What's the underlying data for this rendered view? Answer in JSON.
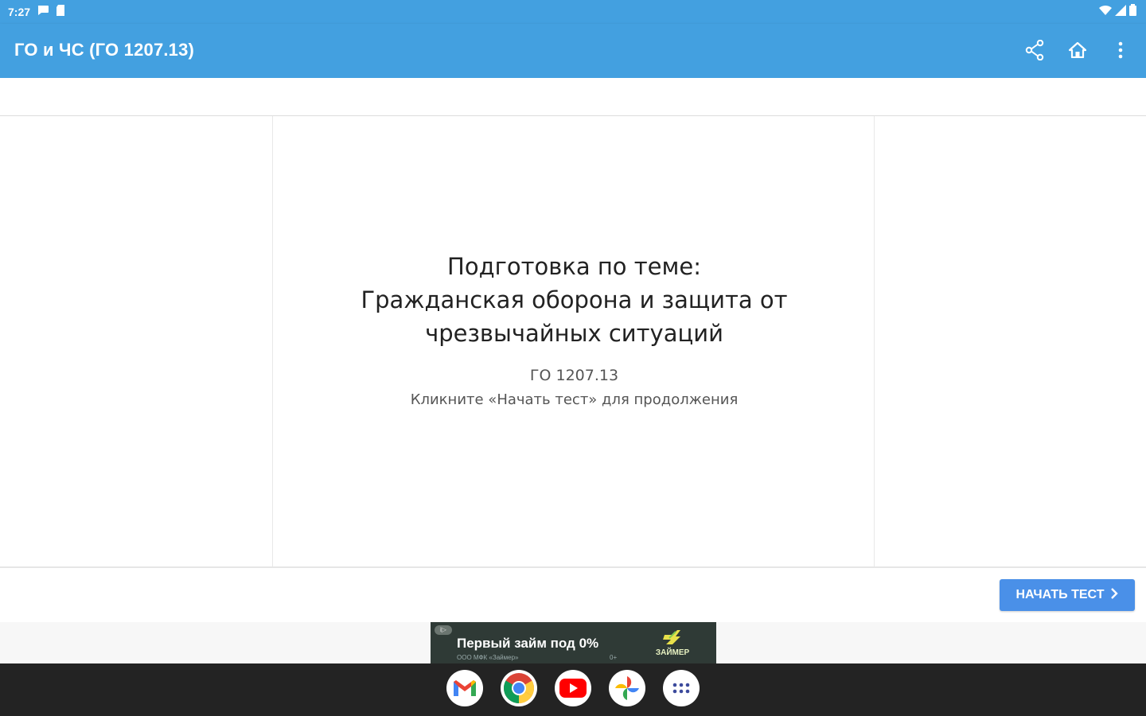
{
  "status_bar": {
    "time": "7:27"
  },
  "app_bar": {
    "title": "ГО и ЧС (ГО 1207.13)",
    "actions": [
      "share-icon",
      "home-icon",
      "more-vert-icon"
    ]
  },
  "slide": {
    "heading_line1": "Подготовка по теме:",
    "heading_line2": "Гражданская оборона и защита от",
    "heading_line3": "чрезвычайных ситуаций",
    "code": "ГО 1207.13",
    "hint": "Кликните «Начать тест» для продолжения"
  },
  "start_button": {
    "label": "НАЧАТЬ ТЕСТ"
  },
  "ad": {
    "title": "Первый займ под 0%",
    "subtitle": "ООО МФК «Займер»",
    "age": "0+",
    "brand": "ЗАЙМЕР"
  },
  "dock": {
    "apps": [
      "gmail-icon",
      "chrome-icon",
      "youtube-icon",
      "photos-icon",
      "app-drawer-icon"
    ]
  },
  "colors": {
    "primary": "#43a0e0",
    "button": "#4a90e8",
    "nav": "#232323"
  }
}
